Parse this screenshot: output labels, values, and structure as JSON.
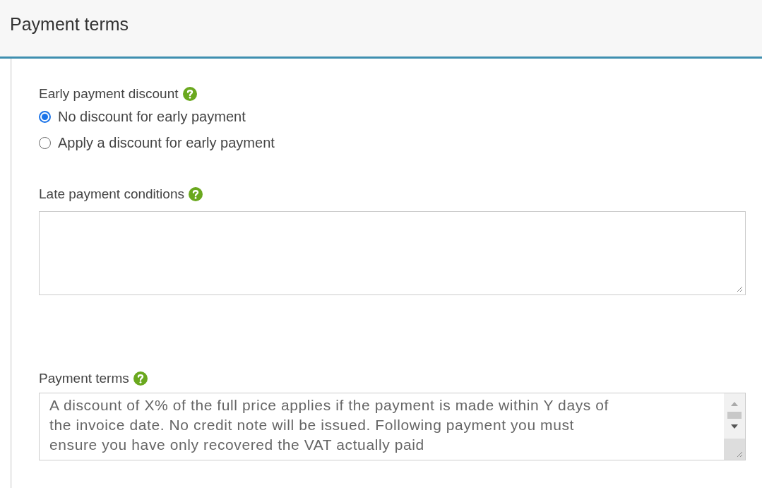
{
  "section": {
    "title": "Payment terms"
  },
  "early_payment": {
    "label": "Early payment discount",
    "help": true,
    "options": [
      {
        "label": "No discount for early payment",
        "selected": true
      },
      {
        "label": "Apply a discount for early payment",
        "selected": false
      }
    ]
  },
  "late_payment": {
    "label": "Late payment conditions",
    "help": true
  },
  "payment_terms": {
    "label": "Payment terms",
    "help": true,
    "value": "A discount of X% of the full price applies if the payment is made within Y days of the invoice date. No credit note will be issued. Following payment you must ensure you have only recovered the VAT actually paid"
  }
}
